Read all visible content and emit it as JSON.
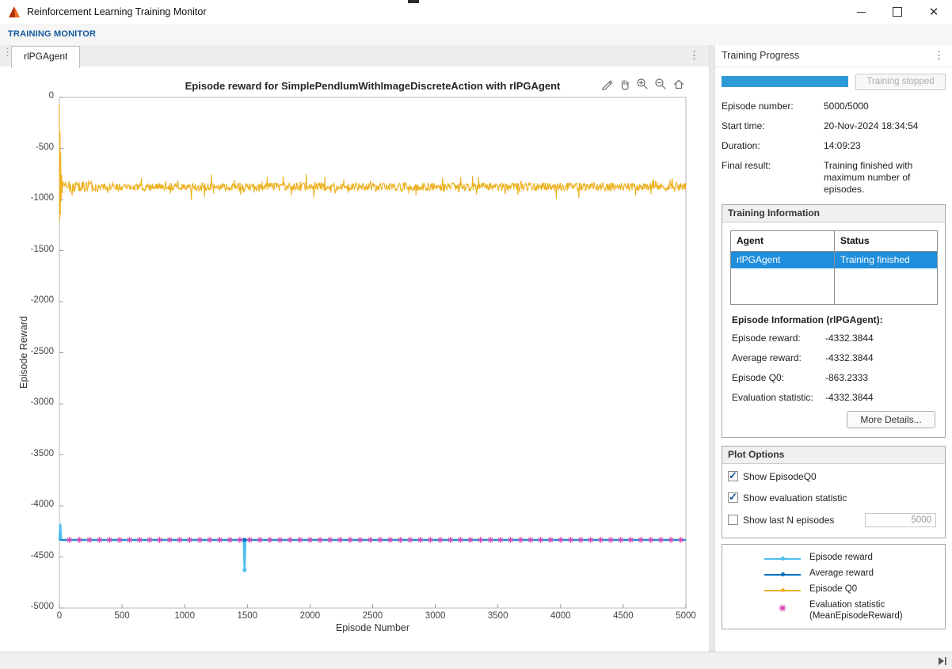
{
  "window": {
    "title": "Reinforcement Learning Training Monitor",
    "controls": [
      "minimize-icon",
      "maximize-icon",
      "close-icon"
    ]
  },
  "toolstrip": {
    "tab": "TRAINING MONITOR"
  },
  "document": {
    "tab": "rlPGAgent"
  },
  "chart_toolbar": {
    "icons": [
      "brush-icon",
      "pan-hand-icon",
      "zoom-in-icon",
      "zoom-out-icon",
      "home-icon"
    ]
  },
  "chart_data": {
    "type": "line",
    "title": "Episode reward for SimplePendlumWithImageDiscreteAction with rlPGAgent",
    "xlabel": "Episode Number",
    "ylabel": "Episode Reward",
    "xlim": [
      0,
      5000
    ],
    "ylim": [
      -5000,
      0
    ],
    "xticks": [
      0,
      500,
      1000,
      1500,
      2000,
      2500,
      3000,
      3500,
      4000,
      4500,
      5000
    ],
    "yticks": [
      0,
      -500,
      -1000,
      -1500,
      -2000,
      -2500,
      -3000,
      -3500,
      -4000,
      -4500,
      -5000
    ],
    "grid": false,
    "series": [
      {
        "name": "Episode Q0",
        "color": "#EDB120",
        "type": "noisy",
        "baseline": -876,
        "noise": 40,
        "spike_prob": 0.08,
        "spike_extra": 95,
        "step": 4,
        "x_start": 30,
        "x_end": 5000,
        "wide_until": 320,
        "start_points": [
          [
            0,
            -60
          ],
          [
            2,
            -1210
          ],
          [
            5,
            -330
          ],
          [
            8,
            -1150
          ],
          [
            11,
            -540
          ],
          [
            14,
            -1020
          ],
          [
            18,
            -760
          ],
          [
            23,
            -940
          ],
          [
            27,
            -820
          ]
        ]
      },
      {
        "name": "Episode reward",
        "color": "#4DBEEE",
        "type": "points",
        "width": 2.6,
        "points": [
          [
            0,
            -4332.3844
          ],
          [
            7,
            -4175
          ],
          [
            14,
            -4332.3844
          ],
          [
            1471,
            -4332.3844
          ],
          [
            1478,
            -4627
          ],
          [
            1485,
            -4332.3844
          ],
          [
            5000,
            -4332.3844
          ]
        ],
        "marker_points": [
          [
            1478,
            -4627
          ]
        ]
      },
      {
        "name": "Average reward",
        "color": "#0072BD",
        "type": "points",
        "width": 1.4,
        "points": [
          [
            0,
            -4332.3844
          ],
          [
            5000,
            -4332.3844
          ]
        ],
        "marker_points": [
          [
            1478,
            -4332.3844
          ]
        ]
      },
      {
        "name": "Evaluation statistic (MeanEpisodeReward)",
        "color": "#DF3FB1",
        "type": "markers",
        "marker": "asterisk",
        "y": -4332.3844,
        "x_start": 80,
        "x_step": 80,
        "x_end": 5000
      }
    ]
  },
  "progress": {
    "title": "Training Progress",
    "stop_button": "Training stopped",
    "progress_percent": 100,
    "bar_color": "#2c9bd8",
    "fields": [
      {
        "label": "Episode number:",
        "value": "5000/5000"
      },
      {
        "label": "Start time:",
        "value": "20-Nov-2024 18:34:54"
      },
      {
        "label": "Duration:",
        "value": "14:09:23"
      },
      {
        "label": "Final result:",
        "value": "Training finished with maximum number of episodes."
      }
    ]
  },
  "training_info": {
    "title": "Training Information",
    "table": {
      "headers": [
        "Agent",
        "Status"
      ],
      "rows": [
        {
          "agent": "rlPGAgent",
          "status": "Training finished",
          "selected": true
        }
      ]
    },
    "episode_info_title": "Episode Information (rlPGAgent):",
    "fields": [
      {
        "label": "Episode reward:",
        "value": "-4332.3844"
      },
      {
        "label": "Average reward:",
        "value": "-4332.3844"
      },
      {
        "label": "Episode Q0:",
        "value": "-863.2333"
      },
      {
        "label": "Evaluation statistic:",
        "value": "-4332.3844"
      }
    ],
    "more_details_button": "More Details..."
  },
  "plot_options": {
    "title": "Plot Options",
    "options": [
      {
        "label": "Show EpisodeQ0",
        "checked": true
      },
      {
        "label": "Show evaluation statistic",
        "checked": true
      },
      {
        "label": "Show last N episodes",
        "checked": false
      }
    ],
    "last_n_value": "5000"
  },
  "legend": {
    "items": [
      {
        "label": "Episode reward",
        "color": "#4DBEEE",
        "marker": "line"
      },
      {
        "label": "Average reward",
        "color": "#0072BD",
        "marker": "line"
      },
      {
        "label": "Episode Q0",
        "color": "#EDB120",
        "marker": "line"
      },
      {
        "label": "Evaluation statistic",
        "sublabel": "(MeanEpisodeReward)",
        "color": "#DF3FB1",
        "marker": "asterisk"
      }
    ]
  }
}
